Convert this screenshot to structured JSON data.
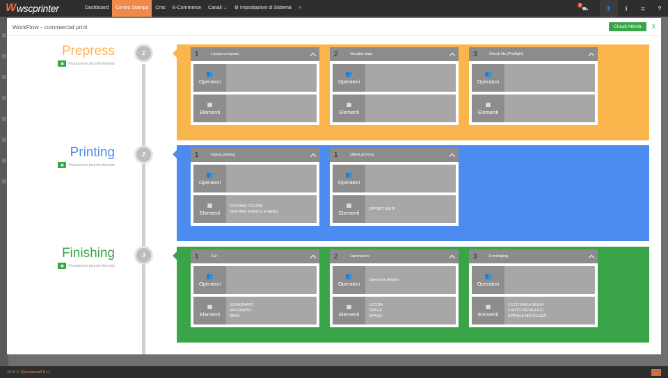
{
  "colors": {
    "prepress": "#fbb54d",
    "printing": "#4c8cf0",
    "finishing": "#3aa548",
    "accent": "#f08a4b"
  },
  "brand": {
    "logo": "wscprinter"
  },
  "nav": {
    "items": [
      "Dashboard",
      "Centro Stampa",
      "Cms",
      "E-Commerce",
      "Canali",
      "Impostazioni di Sistema"
    ],
    "active_index": 1,
    "canali_caret": "⌄",
    "settings_icon": "⚙",
    "search_icon": "⌕",
    "cart_badge": "0",
    "cart_icon": "⛟",
    "user_icon": "👤",
    "info_icon": "ℹ",
    "list_icon": "≣",
    "help_icon": "?"
  },
  "modal": {
    "title": "WorkFlow - commercial print",
    "close_label": "Chiudi Attività",
    "close_x": "X"
  },
  "labels": {
    "operatori": "Operatori",
    "elementi": "Elementi"
  },
  "stages": [
    {
      "name": "Prepress",
      "number": "1",
      "subtitle": "Produzione piccolo formato",
      "cards": [
        {
          "num": "1",
          "title": "Layout compose",
          "operatori": [],
          "elementi": []
        },
        {
          "num": "2",
          "title": "Variable data",
          "operatori": [],
          "elementi": []
        },
        {
          "num": "3",
          "title": "Check file (Preflight)",
          "operatori": [],
          "elementi": []
        }
      ]
    },
    {
      "name": "Printing",
      "number": "2",
      "subtitle": "Produzione piccolo formato",
      "cards": [
        {
          "num": "1",
          "title": "Digital printing",
          "operatori": [],
          "elementi": [
            "DIGITALE COLORI",
            "DIGITALE BIANCO E NERO"
          ]
        },
        {
          "num": "1",
          "title": "Offset printing",
          "operatori": [],
          "elementi": [
            "OFFSET 50x70"
          ]
        }
      ]
    },
    {
      "name": "Finishing",
      "number": "3",
      "subtitle": "Produzione piccolo formato",
      "cards": [
        {
          "num": "1",
          "title": "Cut",
          "operatori": [],
          "elementi": [
            "SQUADRATO",
            "SAGOMATO",
            "SRA3"
          ]
        },
        {
          "num": "2",
          "title": "Lamination",
          "operatori": [
            "Operatore finitura"
          ],
          "elementi": [
            "LUCIDA",
            "OPACA",
            "OPACA"
          ]
        },
        {
          "num": "3",
          "title": "Enveloping",
          "operatori": [],
          "elementi": [
            "CUCITURA A SELLA",
            "PUNTO METALLICO",
            "SPIRALE METALLICA"
          ]
        }
      ]
    }
  ],
  "footer": {
    "prefix": "2016 ©",
    "company": "Dynamicsoft S.r.l."
  }
}
